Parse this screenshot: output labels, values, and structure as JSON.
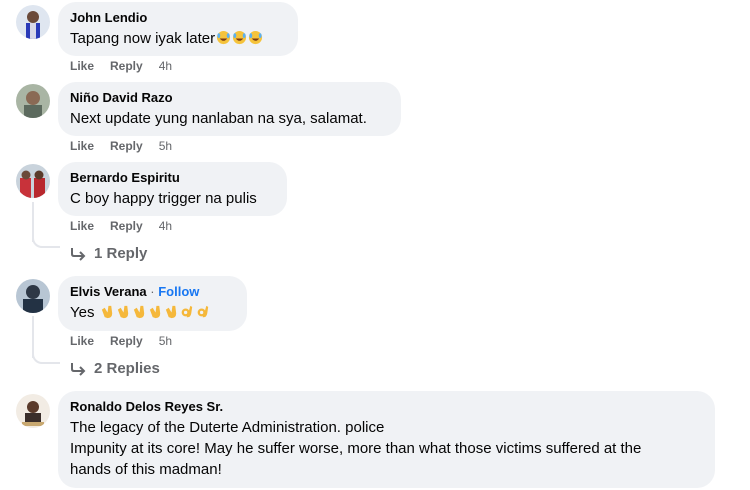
{
  "comments": [
    {
      "author": "John Lendio",
      "text": "Tapang now iyak later",
      "emojis": [
        "rolling-on-floor-laughing",
        "rolling-on-floor-laughing",
        "rolling-on-floor-laughing"
      ],
      "like": "Like",
      "reply": "Reply",
      "time": "4h"
    },
    {
      "author": "Niño David Razo",
      "text": "Next update yung nanlaban na sya, salamat.",
      "like": "Like",
      "reply": "Reply",
      "time": "5h"
    },
    {
      "author": "Bernardo Espiritu",
      "text": "C boy happy trigger na pulis",
      "like": "Like",
      "reply": "Reply",
      "time": "4h",
      "replies": "1 Reply"
    },
    {
      "author": "Elvis Verana",
      "follow_sep": "·",
      "follow": "Follow",
      "text": "Yes",
      "emojis": [
        "clapping-hands",
        "clapping-hands",
        "clapping-hands",
        "clapping-hands",
        "clapping-hands",
        "ok-hand",
        "ok-hand"
      ],
      "like": "Like",
      "reply": "Reply",
      "time": "5h",
      "replies": "2 Replies"
    },
    {
      "author": "Ronaldo Delos Reyes Sr.",
      "text_lines": [
        "The legacy of the Duterte Administration. police",
        "Impunity at its core! May he suffer worse, more than what those victims suffered at the",
        "hands of this madman!"
      ]
    }
  ],
  "colors": {
    "bubble": "#f0f2f5",
    "meta": "#65676b",
    "link": "#1877f2",
    "text": "#050505"
  }
}
